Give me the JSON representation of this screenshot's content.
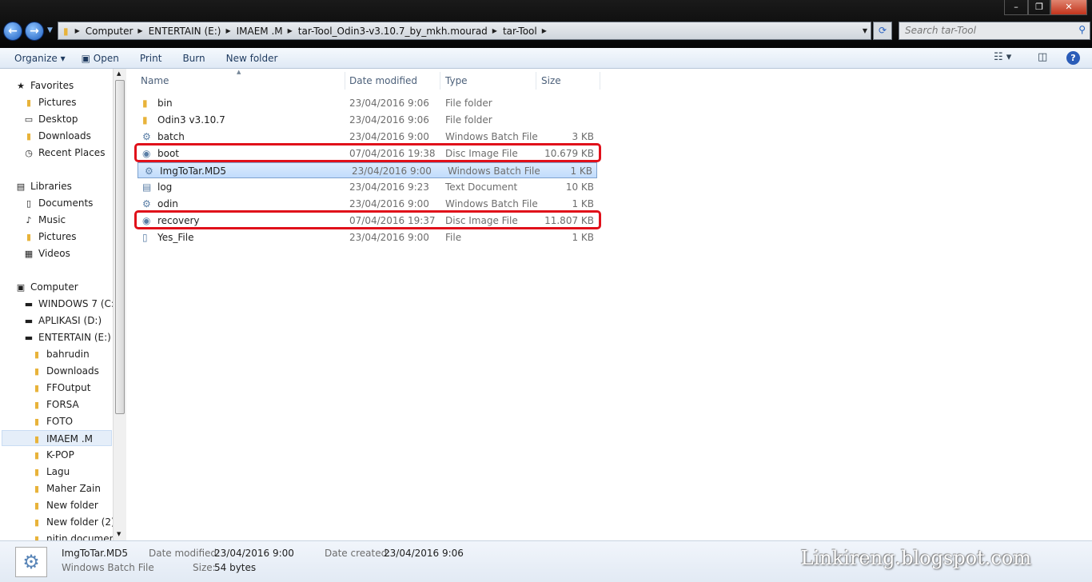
{
  "window": {
    "minimize": "–",
    "restore": "❐",
    "close": "✕"
  },
  "address": {
    "crumbs": [
      "Computer",
      "ENTERTAIN (E:)",
      "IMAEM .M",
      "tar-Tool_Odin3-v3.10.7_by_mkh.mourad",
      "tar-Tool"
    ],
    "search_placeholder": "Search tar-Tool"
  },
  "toolbar": {
    "organize": "Organize ▾",
    "open": "Open",
    "print": "Print",
    "burn": "Burn",
    "new_folder": "New folder"
  },
  "nav": [
    {
      "label": "Favorites",
      "icon": "star-icon",
      "level": 0
    },
    {
      "label": "Pictures",
      "icon": "folder-icon",
      "level": 1
    },
    {
      "label": "Desktop",
      "icon": "desktop-icon",
      "level": 1
    },
    {
      "label": "Downloads",
      "icon": "folder-icon",
      "level": 1
    },
    {
      "label": "Recent Places",
      "icon": "recent-icon",
      "level": 1
    },
    {
      "label": "",
      "icon": "",
      "level": -1
    },
    {
      "label": "Libraries",
      "icon": "library-icon",
      "level": 0
    },
    {
      "label": "Documents",
      "icon": "document-icon",
      "level": 1
    },
    {
      "label": "Music",
      "icon": "music-icon",
      "level": 1
    },
    {
      "label": "Pictures",
      "icon": "folder-icon",
      "level": 1
    },
    {
      "label": "Videos",
      "icon": "video-icon",
      "level": 1
    },
    {
      "label": "",
      "icon": "",
      "level": -1
    },
    {
      "label": "Computer",
      "icon": "computer-icon",
      "level": 0
    },
    {
      "label": "WINDOWS 7 (C:)",
      "icon": "drive-icon",
      "level": 1
    },
    {
      "label": "APLIKASI (D:)",
      "icon": "drive-icon",
      "level": 1
    },
    {
      "label": "ENTERTAIN (E:)",
      "icon": "drive-icon",
      "level": 1
    },
    {
      "label": "bahrudin",
      "icon": "folder-icon",
      "level": 2
    },
    {
      "label": "Downloads",
      "icon": "folder-icon",
      "level": 2
    },
    {
      "label": "FFOutput",
      "icon": "folder-icon",
      "level": 2
    },
    {
      "label": "FORSA",
      "icon": "folder-icon",
      "level": 2
    },
    {
      "label": "FOTO",
      "icon": "folder-icon",
      "level": 2
    },
    {
      "label": "IMAEM .M",
      "icon": "folder-icon",
      "level": 2,
      "selected": true
    },
    {
      "label": "K-POP",
      "icon": "folder-icon",
      "level": 2
    },
    {
      "label": "Lagu",
      "icon": "folder-icon",
      "level": 2
    },
    {
      "label": "Maher Zain",
      "icon": "folder-icon",
      "level": 2
    },
    {
      "label": "New folder",
      "icon": "folder-icon",
      "level": 2
    },
    {
      "label": "New folder (2)",
      "icon": "folder-icon",
      "level": 2
    },
    {
      "label": "nitin documen",
      "icon": "folder-icon",
      "level": 2
    }
  ],
  "columns": [
    "Name",
    "Date modified",
    "Type",
    "Size"
  ],
  "files": [
    {
      "name": "bin",
      "date": "23/04/2016 9:06",
      "type": "File folder",
      "size": "",
      "icon": "folder-icon"
    },
    {
      "name": "Odin3 v3.10.7",
      "date": "23/04/2016 9:06",
      "type": "File folder",
      "size": "",
      "icon": "folder-icon"
    },
    {
      "name": "batch",
      "date": "23/04/2016 9:00",
      "type": "Windows Batch File",
      "size": "3 KB",
      "icon": "batch-file-icon"
    },
    {
      "name": "boot",
      "date": "07/04/2016 19:38",
      "type": "Disc Image File",
      "size": "10.679 KB",
      "icon": "disc-image-icon",
      "highlight": true
    },
    {
      "name": "ImgToTar.MD5",
      "date": "23/04/2016 9:00",
      "type": "Windows Batch File",
      "size": "1 KB",
      "icon": "batch-file-icon",
      "selected": true
    },
    {
      "name": "log",
      "date": "23/04/2016 9:23",
      "type": "Text Document",
      "size": "10 KB",
      "icon": "text-file-icon"
    },
    {
      "name": "odin",
      "date": "23/04/2016 9:00",
      "type": "Windows Batch File",
      "size": "1 KB",
      "icon": "batch-file-icon"
    },
    {
      "name": "recovery",
      "date": "07/04/2016 19:37",
      "type": "Disc Image File",
      "size": "11.807 KB",
      "icon": "disc-image-icon",
      "highlight": true
    },
    {
      "name": "Yes_File",
      "date": "23/04/2016 9:00",
      "type": "File",
      "size": "1 KB",
      "icon": "file-icon"
    }
  ],
  "details": {
    "name": "ImgToTar.MD5",
    "type": "Windows Batch File",
    "modified_label": "Date modified:",
    "modified": "23/04/2016 9:00",
    "created_label": "Date created:",
    "created": "23/04/2016 9:06",
    "size_label": "Size:",
    "size": "54 bytes"
  },
  "watermark": "Linkireng.blogspot.com",
  "colors": {
    "highlight": "#e0101a",
    "selection": "#c1dcfc"
  }
}
